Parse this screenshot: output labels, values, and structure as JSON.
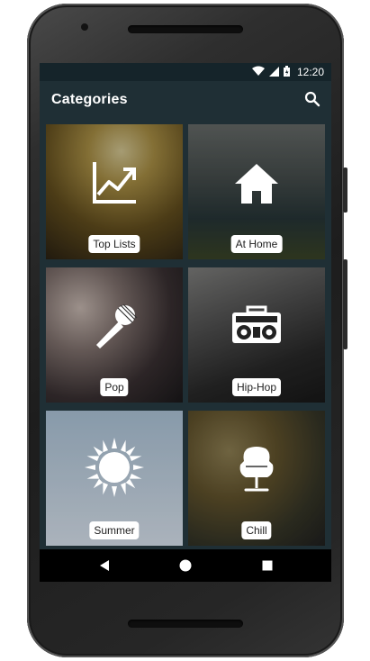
{
  "status_bar": {
    "time": "12:20",
    "wifi_icon": "wifi-icon",
    "signal_icon": "signal-icon",
    "battery_icon": "battery-icon"
  },
  "app_bar": {
    "title": "Categories",
    "search_icon": "search-icon"
  },
  "categories": [
    {
      "label": "Top Lists",
      "icon": "trending-chart-icon"
    },
    {
      "label": "At Home",
      "icon": "home-icon"
    },
    {
      "label": "Pop",
      "icon": "microphone-icon"
    },
    {
      "label": "Hip-Hop",
      "icon": "boombox-icon"
    },
    {
      "label": "Summer",
      "icon": "sun-icon"
    },
    {
      "label": "Chill",
      "icon": "egg-chair-icon"
    }
  ],
  "nav_bar": {
    "back_icon": "back-icon",
    "home_icon": "home-circle-icon",
    "recents_icon": "recents-icon"
  },
  "colors": {
    "app_bar": "#1f2f35",
    "status_bar": "#15242a",
    "label_bg": "#ffffff",
    "nav_bar": "#000000"
  }
}
